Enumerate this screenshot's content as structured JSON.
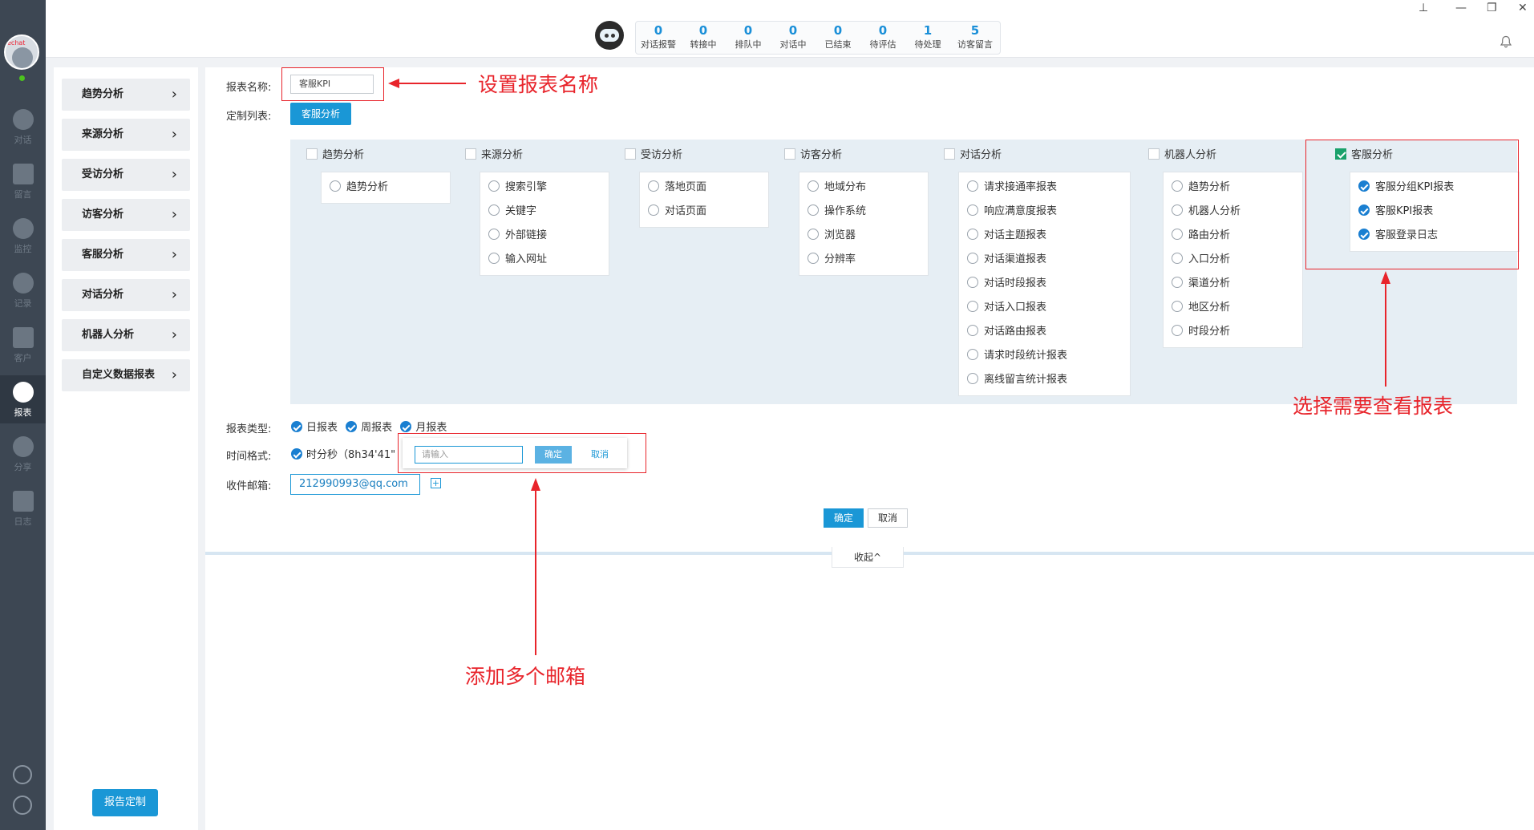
{
  "rail": {
    "avatar_tag": "echat",
    "items": [
      {
        "label": "对话"
      },
      {
        "label": "留言"
      },
      {
        "label": "监控"
      },
      {
        "label": "记录"
      },
      {
        "label": "客户"
      },
      {
        "label": "报表"
      },
      {
        "label": "分享"
      },
      {
        "label": "日志"
      }
    ]
  },
  "header": {
    "stats": [
      {
        "num": "0",
        "name": "对话报警"
      },
      {
        "num": "0",
        "name": "转接中"
      },
      {
        "num": "0",
        "name": "排队中"
      },
      {
        "num": "0",
        "name": "对话中"
      },
      {
        "num": "0",
        "name": "已结束"
      },
      {
        "num": "0",
        "name": "待评估"
      },
      {
        "num": "1",
        "name": "待处理"
      },
      {
        "num": "5",
        "name": "访客留言"
      }
    ]
  },
  "menu": {
    "items": [
      "趋势分析",
      "来源分析",
      "受访分析",
      "访客分析",
      "客服分析",
      "对话分析",
      "机器人分析",
      "自定义数据报表"
    ],
    "custom_button": "报告定制"
  },
  "form": {
    "name_label": "报表名称:",
    "name_value": "客服KPI",
    "list_label": "定制列表:",
    "list_tab": "客服分析",
    "groups": [
      {
        "title": "趋势分析",
        "checked": false,
        "items": [
          {
            "label": "趋势分析",
            "on": false
          }
        ]
      },
      {
        "title": "来源分析",
        "checked": false,
        "items": [
          {
            "label": "搜索引擎",
            "on": false
          },
          {
            "label": "关键字",
            "on": false
          },
          {
            "label": "外部链接",
            "on": false
          },
          {
            "label": "输入网址",
            "on": false
          }
        ]
      },
      {
        "title": "受访分析",
        "checked": false,
        "items": [
          {
            "label": "落地页面",
            "on": false
          },
          {
            "label": "对话页面",
            "on": false
          }
        ]
      },
      {
        "title": "访客分析",
        "checked": false,
        "items": [
          {
            "label": "地域分布",
            "on": false
          },
          {
            "label": "操作系统",
            "on": false
          },
          {
            "label": "浏览器",
            "on": false
          },
          {
            "label": "分辨率",
            "on": false
          }
        ]
      },
      {
        "title": "对话分析",
        "checked": false,
        "items": [
          {
            "label": "请求接通率报表",
            "on": false
          },
          {
            "label": "响应满意度报表",
            "on": false
          },
          {
            "label": "对话主题报表",
            "on": false
          },
          {
            "label": "对话渠道报表",
            "on": false
          },
          {
            "label": "对话时段报表",
            "on": false
          },
          {
            "label": "对话入口报表",
            "on": false
          },
          {
            "label": "对话路由报表",
            "on": false
          },
          {
            "label": "请求时段统计报表",
            "on": false
          },
          {
            "label": "离线留言统计报表",
            "on": false
          }
        ]
      },
      {
        "title": "机器人分析",
        "checked": false,
        "items": [
          {
            "label": "趋势分析",
            "on": false
          },
          {
            "label": "机器人分析",
            "on": false
          },
          {
            "label": "路由分析",
            "on": false
          },
          {
            "label": "入口分析",
            "on": false
          },
          {
            "label": "渠道分析",
            "on": false
          },
          {
            "label": "地区分析",
            "on": false
          },
          {
            "label": "时段分析",
            "on": false
          }
        ]
      },
      {
        "title": "客服分析",
        "checked": true,
        "items": [
          {
            "label": "客服分组KPI报表",
            "on": true
          },
          {
            "label": "客服KPI报表",
            "on": true
          },
          {
            "label": "客服登录日志",
            "on": true
          }
        ]
      }
    ],
    "type_label": "报表类型:",
    "types": [
      "日报表",
      "周报表",
      "月报表"
    ],
    "time_label": "时间格式:",
    "time_value": "时分秒（8h34'41\"",
    "email_label": "收件邮箱:",
    "email_value": "212990993@qq.com",
    "popup": {
      "placeholder": "请输入",
      "ok": "确定",
      "cancel": "取消"
    },
    "ok": "确定",
    "cancel": "取消",
    "collapse": "收起^"
  },
  "annotations": {
    "set_name": "设置报表名称",
    "select_report": "选择需要查看报表",
    "add_emails": "添加多个邮箱"
  },
  "colors": {
    "accent": "#1a97d6",
    "annotation": "#e8242b",
    "sidebar": "#3d4753"
  }
}
